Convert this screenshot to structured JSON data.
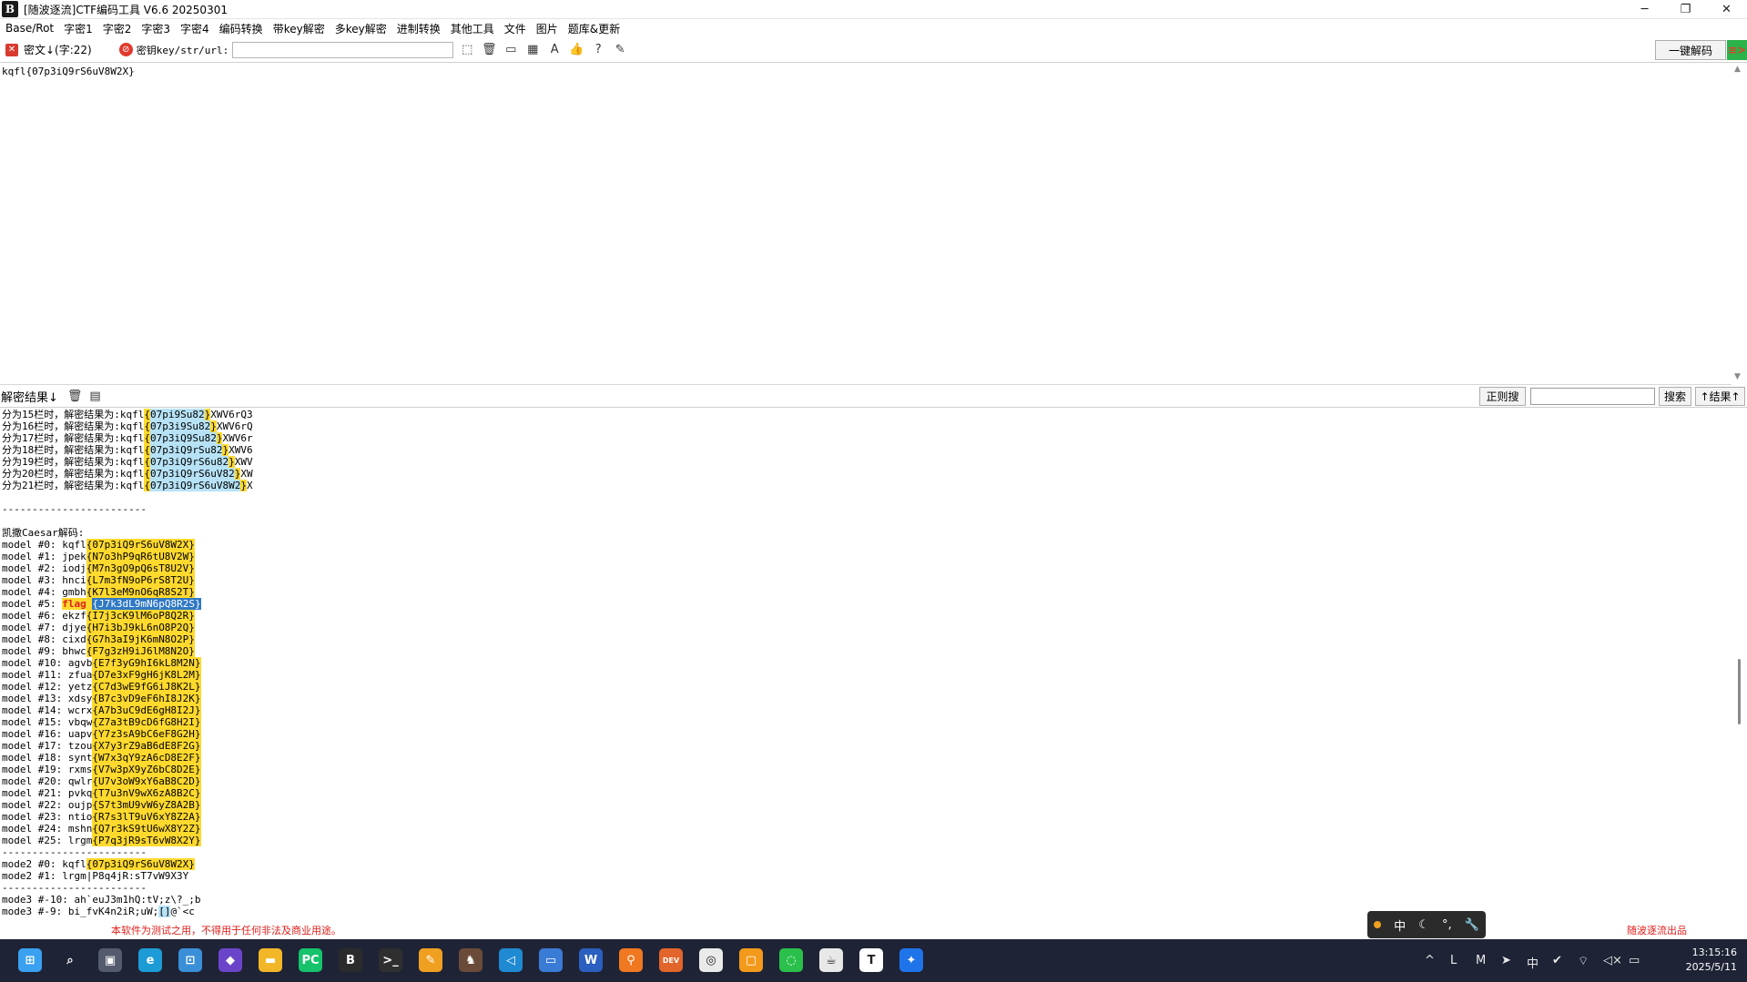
{
  "window": {
    "icon_text": "B",
    "title": "[随波逐流]CTF编码工具 V6.6 20250301",
    "controls": [
      "─",
      "❐",
      "✕"
    ]
  },
  "menu": [
    "Base/Rot",
    "字密1",
    "字密2",
    "字密3",
    "字密4",
    "编码转换",
    "带key解密",
    "多key解密",
    "进制转换",
    "其他工具",
    "文件",
    "图片",
    "题库&更新"
  ],
  "toolbar": {
    "cipher_label": "密文↓(字:22)",
    "key_label": "密钥key/str/url:",
    "key_value": "",
    "decode_all": "一键解码",
    "side_flag": "≡>"
  },
  "cipher": {
    "text": "kqfl{07p3iQ9rS6uV8W2X}"
  },
  "result_header": {
    "title": "解密结果↓",
    "regex_button": "正则搜",
    "search_value": "",
    "search_button": "搜索",
    "result_button": "↑结果↑"
  },
  "result_lines": [
    [
      [
        "分为15栏时，解密结果为:kqfl",
        ""
      ],
      [
        "{",
        "y"
      ],
      [
        "07pi9Su82",
        "b"
      ],
      [
        "}",
        "y"
      ],
      [
        "XWV6rQ3",
        ""
      ]
    ],
    [
      [
        "分为16栏时，解密结果为:kqfl",
        ""
      ],
      [
        "{",
        "y"
      ],
      [
        "07p3i9Su82",
        "b"
      ],
      [
        "}",
        "y"
      ],
      [
        "XWV6rQ",
        ""
      ]
    ],
    [
      [
        "分为17栏时，解密结果为:kqfl",
        ""
      ],
      [
        "{",
        "y"
      ],
      [
        "07p3iQ9Su82",
        "b"
      ],
      [
        "}",
        "y"
      ],
      [
        "XWV6r",
        ""
      ]
    ],
    [
      [
        "分为18栏时，解密结果为:kqfl",
        ""
      ],
      [
        "{",
        "y"
      ],
      [
        "07p3iQ9rSu82",
        "b"
      ],
      [
        "}",
        "y"
      ],
      [
        "XWV6",
        ""
      ]
    ],
    [
      [
        "分为19栏时，解密结果为:kqfl",
        ""
      ],
      [
        "{",
        "y"
      ],
      [
        "07p3iQ9rS6u82",
        "b"
      ],
      [
        "}",
        "y"
      ],
      [
        "XWV",
        ""
      ]
    ],
    [
      [
        "分为20栏时，解密结果为:kqfl",
        ""
      ],
      [
        "{",
        "y"
      ],
      [
        "07p3iQ9rS6uV82",
        "b"
      ],
      [
        "}",
        "y"
      ],
      [
        "XW",
        ""
      ]
    ],
    [
      [
        "分为21栏时，解密结果为:kqfl",
        ""
      ],
      [
        "{",
        "y"
      ],
      [
        "07p3iQ9rS6uV8W2",
        "b"
      ],
      [
        "}",
        "y"
      ],
      [
        "X",
        ""
      ]
    ],
    [
      [
        "",
        ""
      ]
    ],
    [
      [
        "------------------------",
        ""
      ]
    ],
    [
      [
        "",
        ""
      ]
    ],
    [
      [
        "凯撒Caesar解码:",
        ""
      ]
    ],
    [
      [
        "model #0: kqfl",
        ""
      ],
      [
        "{07p3iQ9rS6uV8W2X}",
        "y"
      ]
    ],
    [
      [
        "model #1: jpek",
        ""
      ],
      [
        "{N7o3hP9qR6tU8V2W}",
        "y"
      ]
    ],
    [
      [
        "model #2: iodj",
        ""
      ],
      [
        "{M7n3gO9pQ6sT8U2V}",
        "y"
      ]
    ],
    [
      [
        "model #3: hnci",
        ""
      ],
      [
        "{L7m3fN9oP6rS8T2U}",
        "y"
      ]
    ],
    [
      [
        "model #4: gmbh",
        ""
      ],
      [
        "{K7l3eM9nO6qR8S2T}",
        "y"
      ]
    ],
    [
      [
        "model #5: ",
        ""
      ],
      [
        "flag",
        "r"
      ],
      [
        " ",
        "y"
      ],
      [
        "{J7k3dL9mN6pQ8R2S}",
        "s"
      ]
    ],
    [
      [
        "model #6: ekzf",
        ""
      ],
      [
        "{I7j3cK9lM6oP8Q2R}",
        "y"
      ]
    ],
    [
      [
        "model #7: djye",
        ""
      ],
      [
        "{H7i3bJ9kL6nO8P2Q}",
        "y"
      ]
    ],
    [
      [
        "model #8: cixd",
        ""
      ],
      [
        "{G7h3aI9jK6mN8O2P}",
        "y"
      ]
    ],
    [
      [
        "model #9: bhwc",
        ""
      ],
      [
        "{F7g3zH9iJ6lM8N2O}",
        "y"
      ]
    ],
    [
      [
        "model #10: agvb",
        ""
      ],
      [
        "{E7f3yG9hI6kL8M2N}",
        "y"
      ]
    ],
    [
      [
        "model #11: zfua",
        ""
      ],
      [
        "{D7e3xF9gH6jK8L2M}",
        "y"
      ]
    ],
    [
      [
        "model #12: yetz",
        ""
      ],
      [
        "{C7d3wE9fG6iJ8K2L}",
        "y"
      ]
    ],
    [
      [
        "model #13: xdsy",
        ""
      ],
      [
        "{B7c3vD9eF6hI8J2K}",
        "y"
      ]
    ],
    [
      [
        "model #14: wcrx",
        ""
      ],
      [
        "{A7b3uC9dE6gH8I2J}",
        "y"
      ]
    ],
    [
      [
        "model #15: vbqw",
        ""
      ],
      [
        "{Z7a3tB9cD6fG8H2I}",
        "y"
      ]
    ],
    [
      [
        "model #16: uapv",
        ""
      ],
      [
        "{Y7z3sA9bC6eF8G2H}",
        "y"
      ]
    ],
    [
      [
        "model #17: tzou",
        ""
      ],
      [
        "{X7y3rZ9aB6dE8F2G}",
        "y"
      ]
    ],
    [
      [
        "model #18: synt",
        ""
      ],
      [
        "{W7x3qY9zA6cD8E2F}",
        "y"
      ]
    ],
    [
      [
        "model #19: rxms",
        ""
      ],
      [
        "{V7w3pX9yZ6bC8D2E}",
        "y"
      ]
    ],
    [
      [
        "model #20: qwlr",
        ""
      ],
      [
        "{U7v3oW9xY6aB8C2D}",
        "y"
      ]
    ],
    [
      [
        "model #21: pvkq",
        ""
      ],
      [
        "{T7u3nV9wX6zA8B2C}",
        "y"
      ]
    ],
    [
      [
        "model #22: oujp",
        ""
      ],
      [
        "{S7t3mU9vW6yZ8A2B}",
        "y"
      ]
    ],
    [
      [
        "model #23: ntio",
        ""
      ],
      [
        "{R7s3lT9uV6xY8Z2A}",
        "y"
      ]
    ],
    [
      [
        "model #24: mshn",
        ""
      ],
      [
        "{Q7r3kS9tU6wX8Y2Z}",
        "y"
      ]
    ],
    [
      [
        "model #25: lrgm",
        ""
      ],
      [
        "{P7q3jR9sT6vW8X2Y}",
        "y"
      ]
    ],
    [
      [
        "------------------------",
        ""
      ]
    ],
    [
      [
        "mode2 #0: kqfl",
        ""
      ],
      [
        "{07p3iQ9rS6uV8W2X}",
        "y"
      ]
    ],
    [
      [
        "mode2 #1: lrgm|P8q4jR:sT7vW9X3Y",
        ""
      ]
    ],
    [
      [
        "------------------------",
        ""
      ]
    ],
    [
      [
        "mode3 #-10: ah`euJ3m1hQ:tV;z\\?_;b",
        ""
      ]
    ],
    [
      [
        "mode3 #-9: bi_fvK4n2iR;uW;",
        ""
      ],
      [
        "[]",
        "b"
      ],
      [
        "@`<c",
        ""
      ]
    ]
  ],
  "footer": {
    "notice": "本软件为测试之用，不得用于任何非法及商业用途。",
    "credit": "随波逐流出品"
  },
  "ime": {
    "lang": "中",
    "moon": "☾",
    "dots": "°,",
    "tool": "🔧"
  },
  "taskbar": {
    "apps": [
      {
        "name": "start",
        "glyph": "⊞",
        "color": "#3aa0f0"
      },
      {
        "name": "search",
        "glyph": "⌕",
        "color": "#1f2336"
      },
      {
        "name": "task-view",
        "glyph": "▣",
        "color": "#555b6e"
      },
      {
        "name": "edge",
        "glyph": "e",
        "color": "#1d9bd6"
      },
      {
        "name": "store",
        "glyph": "⊡",
        "color": "#3b8fd8"
      },
      {
        "name": "crystal",
        "glyph": "◆",
        "color": "#6b45c9"
      },
      {
        "name": "explorer",
        "glyph": "▬",
        "color": "#f2b728"
      },
      {
        "name": "pycharm",
        "glyph": "PC",
        "color": "#16c26c"
      },
      {
        "name": "ctf-tool",
        "glyph": "B",
        "color": "#2b2b2b"
      },
      {
        "name": "terminal",
        "glyph": ">_",
        "color": "#2f2f2f"
      },
      {
        "name": "note-app",
        "glyph": "✎",
        "color": "#f0a020"
      },
      {
        "name": "character-app",
        "glyph": "♞",
        "color": "#6a4b3a"
      },
      {
        "name": "vscode",
        "glyph": "◁",
        "color": "#1f8ad2"
      },
      {
        "name": "remote-desktop",
        "glyph": "▭",
        "color": "#3a7bd5"
      },
      {
        "name": "word",
        "glyph": "W",
        "color": "#2b5fc0"
      },
      {
        "name": "search-tool",
        "glyph": "⚲",
        "color": "#f07820"
      },
      {
        "name": "dev-app",
        "glyph": "DEV",
        "color": "#e2652b"
      },
      {
        "name": "chrome-app",
        "glyph": "◎",
        "color": "#eaeaea"
      },
      {
        "name": "box-app",
        "glyph": "▢",
        "color": "#f39a1c"
      },
      {
        "name": "wechat",
        "glyph": "◌",
        "color": "#2bc04b"
      },
      {
        "name": "java-app",
        "glyph": "☕",
        "color": "#e8e8e8"
      },
      {
        "name": "typora",
        "glyph": "T",
        "color": "#ffffff"
      },
      {
        "name": "feishu",
        "glyph": "✦",
        "color": "#1e74e8"
      }
    ],
    "tray": [
      "^",
      "L",
      "M",
      "➤",
      "中",
      "✔",
      "⌔",
      "◁×",
      "▭"
    ],
    "time": "13:15:16",
    "date": "2025/5/11"
  },
  "colors": {
    "title_bg": "#ffffff",
    "taskbar_bg": "#1f2336",
    "highlight_yellow": "#ffd92e",
    "highlight_blue": "#b7e2f6",
    "selection": "#2f78c4",
    "flag_red": "#e02020",
    "footer_red": "#e0201c"
  }
}
